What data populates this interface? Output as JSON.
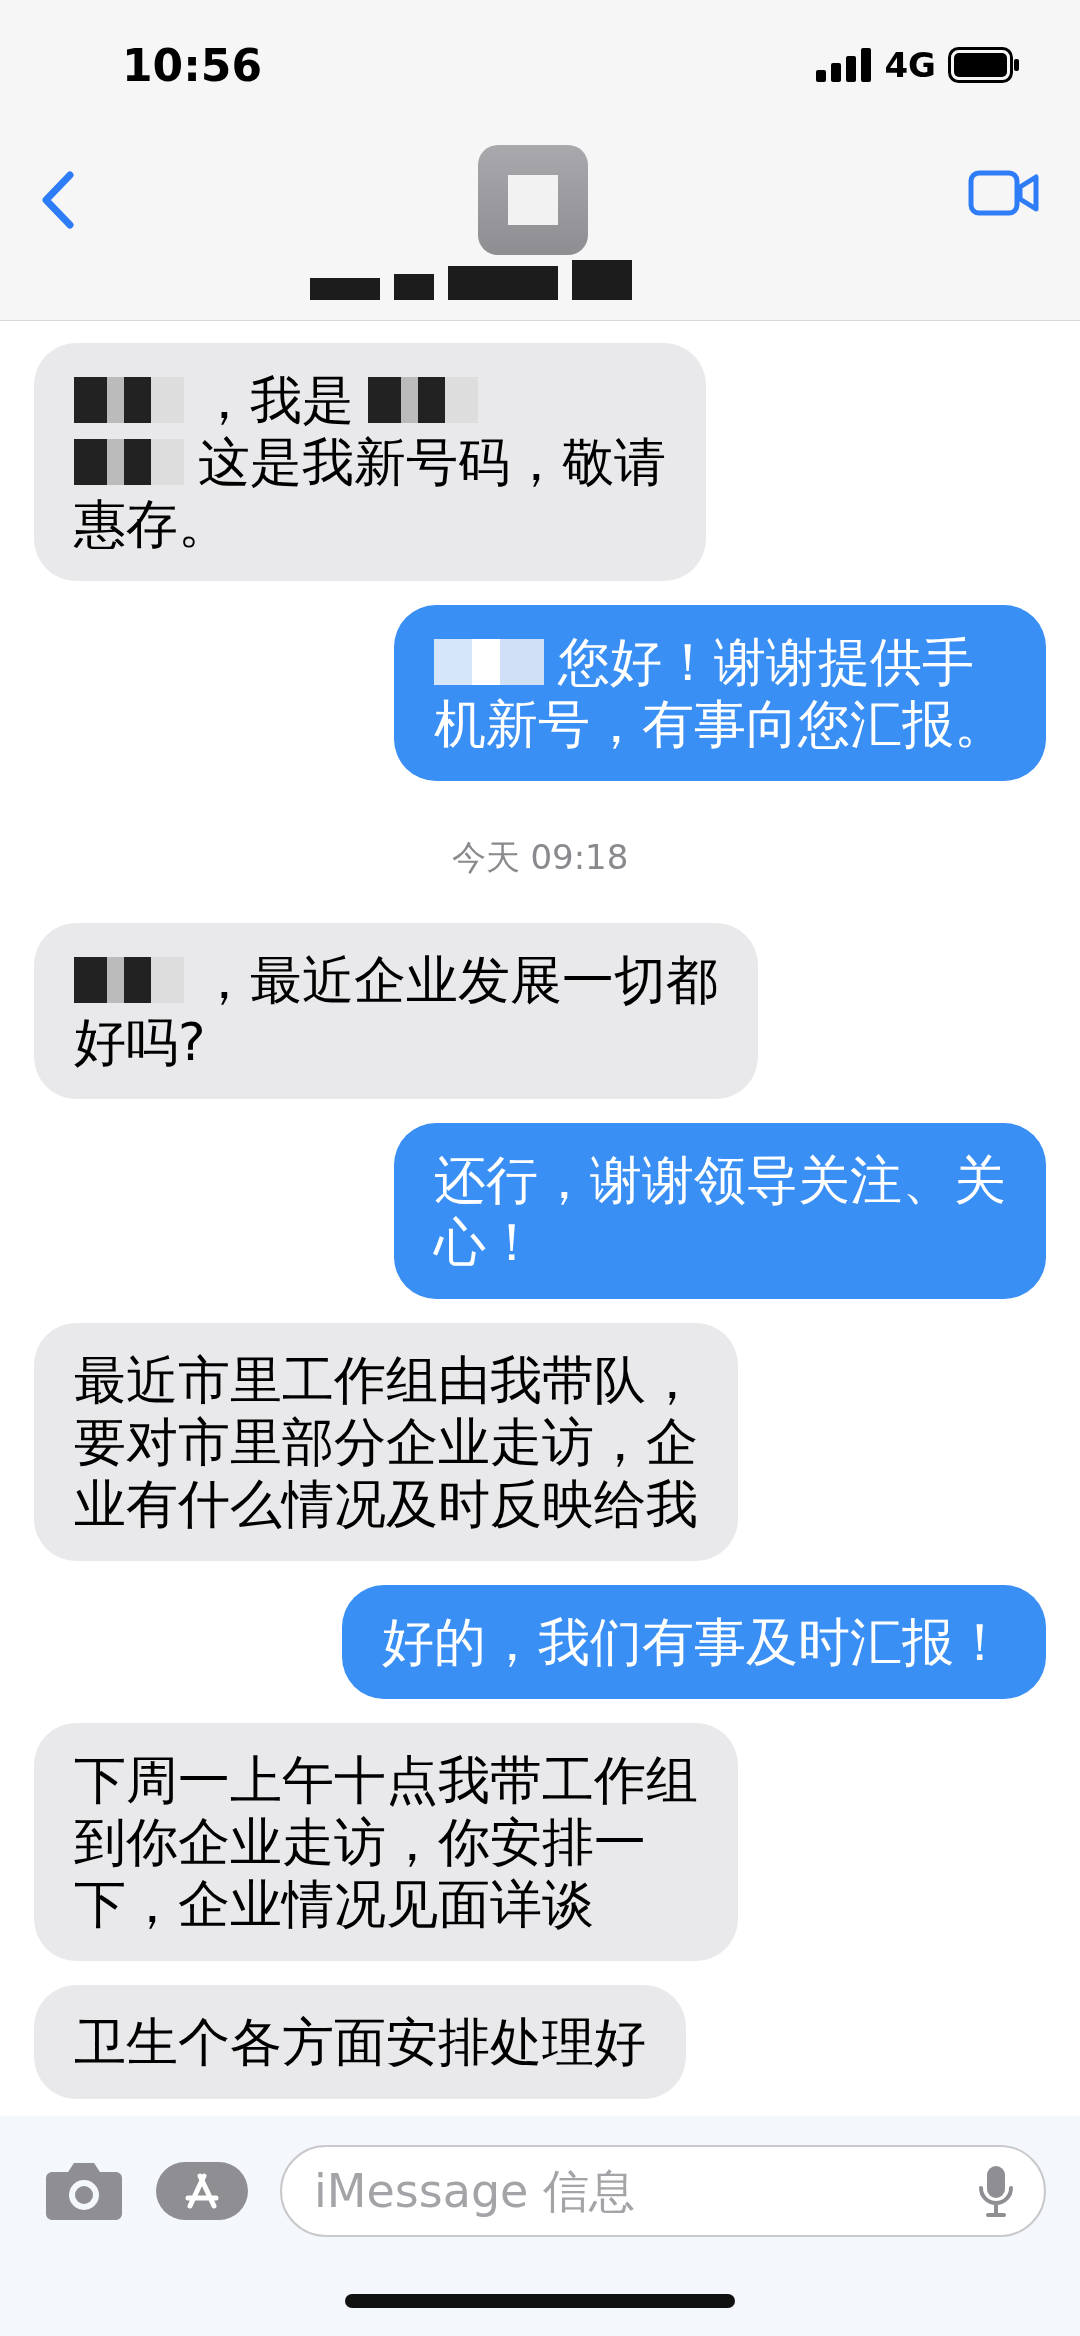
{
  "status_bar": {
    "time": "10:56",
    "network": "4G"
  },
  "header": {
    "kind": "redacted"
  },
  "messages": [
    {
      "kind": "incoming",
      "lines": [
        [
          {
            "kind": "redacted"
          },
          {
            "kind": "text",
            "text": "，我是"
          },
          {
            "kind": "redacted"
          }
        ],
        [
          {
            "kind": "redacted"
          },
          {
            "kind": "text",
            "text": "这是我新号码，敬请"
          }
        ],
        [
          {
            "kind": "text",
            "text": "惠存。"
          }
        ]
      ]
    },
    {
      "kind": "outgoing",
      "lines": [
        [
          {
            "kind": "redacted"
          },
          {
            "kind": "text",
            "text": "您好！谢谢提供手"
          }
        ],
        [
          {
            "kind": "text",
            "text": "机新号，有事向您汇报。"
          }
        ]
      ]
    },
    {
      "kind": "timestamp",
      "text": "今天 09:18"
    },
    {
      "kind": "incoming",
      "lines": [
        [
          {
            "kind": "redacted"
          },
          {
            "kind": "text",
            "text": "，最近企业发展一切都"
          }
        ],
        [
          {
            "kind": "text",
            "text": "好吗?"
          }
        ]
      ]
    },
    {
      "kind": "outgoing",
      "lines": [
        [
          {
            "kind": "text",
            "text": "还行，谢谢领导关注、关"
          }
        ],
        [
          {
            "kind": "text",
            "text": "心！"
          }
        ]
      ]
    },
    {
      "kind": "incoming",
      "lines": [
        [
          {
            "kind": "text",
            "text": "最近市里工作组由我带队，"
          }
        ],
        [
          {
            "kind": "text",
            "text": "要对市里部分企业走访，企"
          }
        ],
        [
          {
            "kind": "text",
            "text": "业有什么情况及时反映给我"
          }
        ]
      ]
    },
    {
      "kind": "outgoing",
      "lines": [
        [
          {
            "kind": "text",
            "text": "好的，我们有事及时汇报！"
          }
        ]
      ]
    },
    {
      "kind": "incoming",
      "lines": [
        [
          {
            "kind": "text",
            "text": "下周一上午十点我带工作组"
          }
        ],
        [
          {
            "kind": "text",
            "text": "到你企业走访，你安排一"
          }
        ],
        [
          {
            "kind": "text",
            "text": "下，企业情况见面详谈"
          }
        ]
      ]
    },
    {
      "kind": "incoming",
      "lines": [
        [
          {
            "kind": "text",
            "text": "卫生个各方面安排处理好"
          }
        ]
      ]
    }
  ],
  "input": {
    "placeholder": "iMessage 信息"
  }
}
